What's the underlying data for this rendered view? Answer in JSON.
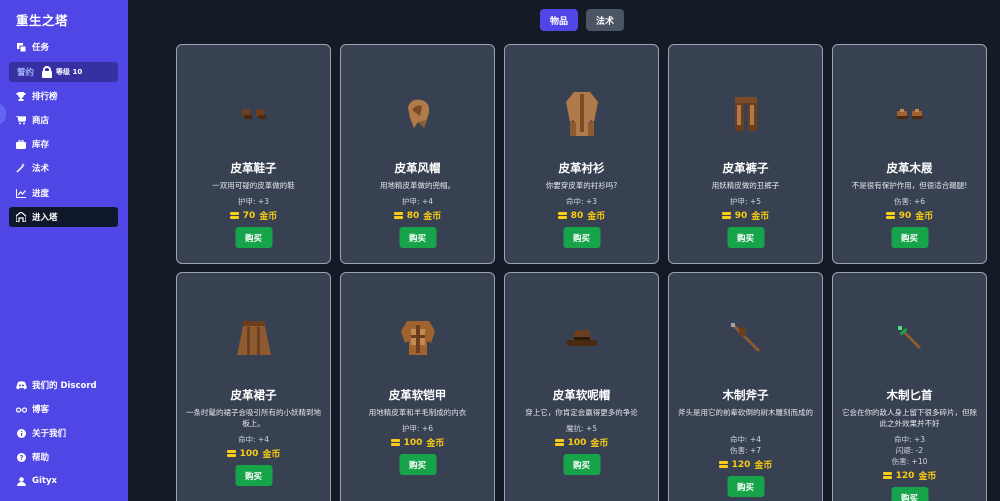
{
  "app": {
    "title": "重生之塔"
  },
  "sidebar": {
    "items": [
      {
        "label": "任务",
        "icon": "tasks-icon"
      },
      {
        "label": "誓约",
        "icon": "lock-icon",
        "badge": "等级 10",
        "locked": true
      },
      {
        "label": "排行榜",
        "icon": "trophy-icon"
      },
      {
        "label": "商店",
        "icon": "cart-icon"
      },
      {
        "label": "库存",
        "icon": "briefcase-icon"
      },
      {
        "label": "法术",
        "icon": "wand-icon"
      },
      {
        "label": "进度",
        "icon": "chart-icon"
      },
      {
        "label": "进入塔",
        "icon": "tower-icon",
        "active": true
      }
    ],
    "footer": [
      {
        "label": "我们的 Discord",
        "icon": "discord-icon"
      },
      {
        "label": "博客",
        "icon": "glasses-icon"
      },
      {
        "label": "关于我们",
        "icon": "info-icon"
      },
      {
        "label": "帮助",
        "icon": "help-icon"
      },
      {
        "label": "Gityx",
        "icon": "user-icon"
      }
    ]
  },
  "tabs": {
    "items": "物品",
    "spells": "法术"
  },
  "shop": {
    "buy_label": "购买",
    "currency": "金币",
    "items": [
      {
        "name": "皮革鞋子",
        "desc": "一双用可疑的皮革做的鞋",
        "stats": [
          "护甲: +3"
        ],
        "price": "70",
        "sprite": "boots"
      },
      {
        "name": "皮革风帽",
        "desc": "用地精皮革做的兜帽。",
        "stats": [
          "护甲: +4"
        ],
        "price": "80",
        "sprite": "hood"
      },
      {
        "name": "皮革衬衫",
        "desc": "你要穿皮革的衬衫吗?",
        "stats": [
          "命中: +3"
        ],
        "price": "80",
        "sprite": "shirt"
      },
      {
        "name": "皮革裤子",
        "desc": "用妖精皮做的丑裤子",
        "stats": [
          "护甲: +5"
        ],
        "price": "90",
        "sprite": "pants"
      },
      {
        "name": "皮革木屐",
        "desc": "不是很有保护作用，但很适合踢腿!",
        "stats": [
          "伤害: +6"
        ],
        "price": "90",
        "sprite": "clogs"
      },
      {
        "name": "皮革裙子",
        "desc": "一条时髦的裙子会吸引所有的小妖精到地板上。",
        "stats": [
          "命中: +4"
        ],
        "price": "100",
        "sprite": "skirt"
      },
      {
        "name": "皮革软铠甲",
        "desc": "用地精皮革和羊毛制成的内衣",
        "stats": [
          "护甲: +6"
        ],
        "price": "100",
        "sprite": "armor"
      },
      {
        "name": "皮革软呢帽",
        "desc": "穿上它，你肯定会赢得更多的争论",
        "stats": [
          "魔抗: +5"
        ],
        "price": "100",
        "sprite": "fedora"
      },
      {
        "name": "木制斧子",
        "desc": "斧头是用它的前辈砍倒的树木雕刻而成的",
        "stats": [
          "命中: +4",
          "伤害: +7"
        ],
        "price": "120",
        "sprite": "axe"
      },
      {
        "name": "木制匕首",
        "desc": "它会在你的敌人身上留下很多碎片，但除此之外效果并不好",
        "stats": [
          "命中: +3",
          "闪避: -2",
          "伤害: +10"
        ],
        "price": "120",
        "sprite": "dagger"
      }
    ]
  }
}
